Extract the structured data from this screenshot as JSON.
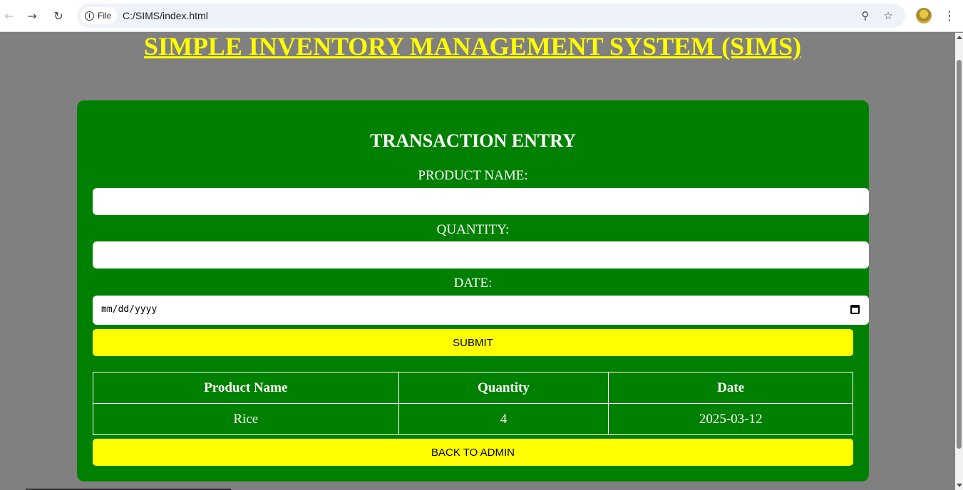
{
  "browser": {
    "chip_label": "File",
    "url": "C:/SIMS/index.html"
  },
  "page": {
    "title": "SIMPLE INVENTORY MANAGEMENT SYSTEM (SIMS)"
  },
  "form": {
    "title": "TRANSACTION ENTRY",
    "product_label": "PRODUCT NAME:",
    "product_value": "",
    "quantity_label": "QUANTITY:",
    "quantity_value": "",
    "date_label": "DATE:",
    "date_placeholder": "mm/dd/yyyy",
    "submit_label": "SUBMIT"
  },
  "table": {
    "headers": [
      "Product Name",
      "Quantity",
      "Date"
    ],
    "rows": [
      [
        "Rice",
        "4",
        "2025-03-12"
      ]
    ]
  },
  "back_button_label": "BACK TO ADMIN",
  "colors": {
    "background": "#808080",
    "card": "#008000",
    "accent": "#ffff00"
  }
}
